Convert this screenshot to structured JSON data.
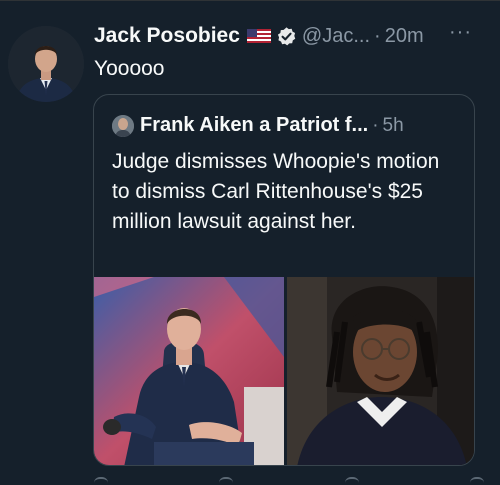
{
  "tweet": {
    "author_name": "Jack Posobiec",
    "handle": "@Jac...",
    "separator": "·",
    "time": "20m",
    "more": "···",
    "text": "Yooooo"
  },
  "quoted": {
    "author_name": "Frank Aiken a Patriot f...",
    "separator": "·",
    "time": "5h",
    "text": "Judge dismisses Whoopie's motion to dismiss Carl Rittenhouse's $25 million lawsuit against her."
  },
  "colors": {
    "background": "#15202b",
    "text_primary": "#f7f9f9",
    "text_secondary": "#8b98a5",
    "border": "#38444d"
  },
  "icons": {
    "flag": "us-flag-icon",
    "verified": "verified-badge-icon",
    "more": "more-options-icon"
  }
}
